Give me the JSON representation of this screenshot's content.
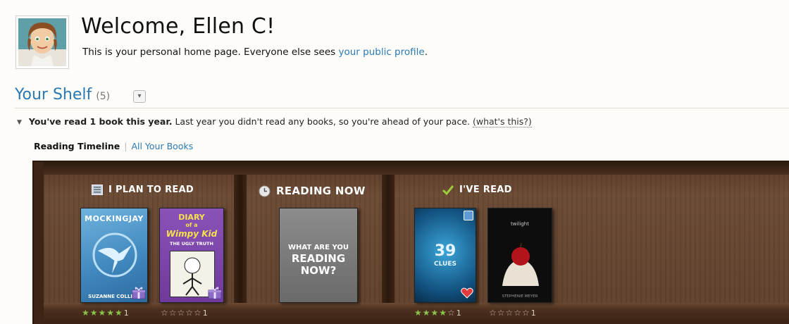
{
  "header": {
    "welcome": "Welcome, Ellen C!",
    "subtitle_prefix": "This is your personal home page. Everyone else sees ",
    "public_profile_link": "your public profile",
    "subtitle_suffix": "."
  },
  "shelf": {
    "title": "Your Shelf",
    "count": "(5)",
    "pace_bold": "You've read 1 book this year.",
    "pace_text": " Last year you didn't read any books, so you're ahead of your pace. ",
    "whats_this": "(what's this?)",
    "nav": {
      "timeline": "Reading Timeline",
      "all_books": "All Your Books"
    }
  },
  "sections": {
    "plan": "I PLAN TO READ",
    "reading": "READING NOW",
    "read": "I'VE READ"
  },
  "books": {
    "mockingjay": {
      "title": "MOCKINGJAY",
      "author": "SUZANNE COLLINS",
      "stars": 5,
      "count": "1"
    },
    "wimpy": {
      "line1": "DIARY",
      "line2": "of a",
      "line3": "Wimpy Kid",
      "line4": "THE UGLY TRUTH",
      "stars": 0,
      "count": "1"
    },
    "placeholder": {
      "text1": "WHAT ARE YOU",
      "text2": "READING",
      "text3": "NOW?"
    },
    "clues": {
      "title": "39",
      "subtitle": "CLUES",
      "stars": 4,
      "count": "1"
    },
    "twilight": {
      "title": "twilight",
      "author": "STEPHENIE MEYER",
      "stars": 0,
      "count": "1"
    }
  },
  "colors": {
    "link": "#2a79b4",
    "star_on": "#8ac24a",
    "star_off": "#bfb5a8"
  }
}
